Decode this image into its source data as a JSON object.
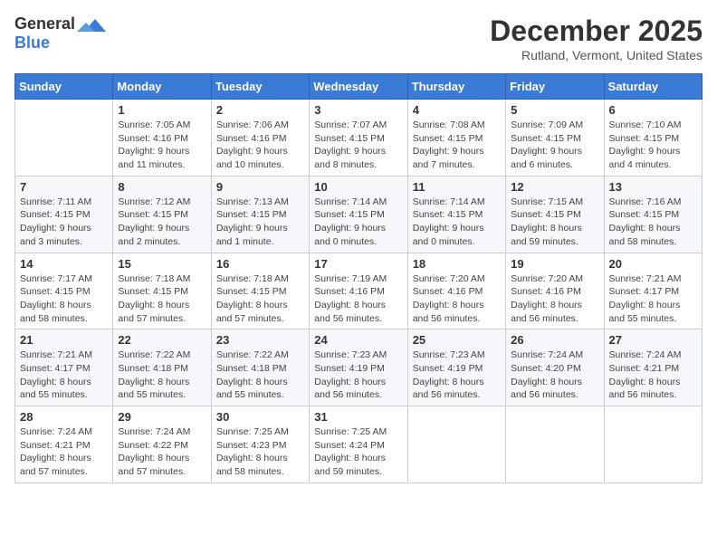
{
  "logo": {
    "general": "General",
    "blue": "Blue"
  },
  "title": "December 2025",
  "subtitle": "Rutland, Vermont, United States",
  "days_of_week": [
    "Sunday",
    "Monday",
    "Tuesday",
    "Wednesday",
    "Thursday",
    "Friday",
    "Saturday"
  ],
  "weeks": [
    [
      {
        "day": "",
        "info": ""
      },
      {
        "day": "1",
        "info": "Sunrise: 7:05 AM\nSunset: 4:16 PM\nDaylight: 9 hours\nand 11 minutes."
      },
      {
        "day": "2",
        "info": "Sunrise: 7:06 AM\nSunset: 4:16 PM\nDaylight: 9 hours\nand 10 minutes."
      },
      {
        "day": "3",
        "info": "Sunrise: 7:07 AM\nSunset: 4:15 PM\nDaylight: 9 hours\nand 8 minutes."
      },
      {
        "day": "4",
        "info": "Sunrise: 7:08 AM\nSunset: 4:15 PM\nDaylight: 9 hours\nand 7 minutes."
      },
      {
        "day": "5",
        "info": "Sunrise: 7:09 AM\nSunset: 4:15 PM\nDaylight: 9 hours\nand 6 minutes."
      },
      {
        "day": "6",
        "info": "Sunrise: 7:10 AM\nSunset: 4:15 PM\nDaylight: 9 hours\nand 4 minutes."
      }
    ],
    [
      {
        "day": "7",
        "info": "Sunrise: 7:11 AM\nSunset: 4:15 PM\nDaylight: 9 hours\nand 3 minutes."
      },
      {
        "day": "8",
        "info": "Sunrise: 7:12 AM\nSunset: 4:15 PM\nDaylight: 9 hours\nand 2 minutes."
      },
      {
        "day": "9",
        "info": "Sunrise: 7:13 AM\nSunset: 4:15 PM\nDaylight: 9 hours\nand 1 minute."
      },
      {
        "day": "10",
        "info": "Sunrise: 7:14 AM\nSunset: 4:15 PM\nDaylight: 9 hours\nand 0 minutes."
      },
      {
        "day": "11",
        "info": "Sunrise: 7:14 AM\nSunset: 4:15 PM\nDaylight: 9 hours\nand 0 minutes."
      },
      {
        "day": "12",
        "info": "Sunrise: 7:15 AM\nSunset: 4:15 PM\nDaylight: 8 hours\nand 59 minutes."
      },
      {
        "day": "13",
        "info": "Sunrise: 7:16 AM\nSunset: 4:15 PM\nDaylight: 8 hours\nand 58 minutes."
      }
    ],
    [
      {
        "day": "14",
        "info": "Sunrise: 7:17 AM\nSunset: 4:15 PM\nDaylight: 8 hours\nand 58 minutes."
      },
      {
        "day": "15",
        "info": "Sunrise: 7:18 AM\nSunset: 4:15 PM\nDaylight: 8 hours\nand 57 minutes."
      },
      {
        "day": "16",
        "info": "Sunrise: 7:18 AM\nSunset: 4:15 PM\nDaylight: 8 hours\nand 57 minutes."
      },
      {
        "day": "17",
        "info": "Sunrise: 7:19 AM\nSunset: 4:16 PM\nDaylight: 8 hours\nand 56 minutes."
      },
      {
        "day": "18",
        "info": "Sunrise: 7:20 AM\nSunset: 4:16 PM\nDaylight: 8 hours\nand 56 minutes."
      },
      {
        "day": "19",
        "info": "Sunrise: 7:20 AM\nSunset: 4:16 PM\nDaylight: 8 hours\nand 56 minutes."
      },
      {
        "day": "20",
        "info": "Sunrise: 7:21 AM\nSunset: 4:17 PM\nDaylight: 8 hours\nand 55 minutes."
      }
    ],
    [
      {
        "day": "21",
        "info": "Sunrise: 7:21 AM\nSunset: 4:17 PM\nDaylight: 8 hours\nand 55 minutes."
      },
      {
        "day": "22",
        "info": "Sunrise: 7:22 AM\nSunset: 4:18 PM\nDaylight: 8 hours\nand 55 minutes."
      },
      {
        "day": "23",
        "info": "Sunrise: 7:22 AM\nSunset: 4:18 PM\nDaylight: 8 hours\nand 55 minutes."
      },
      {
        "day": "24",
        "info": "Sunrise: 7:23 AM\nSunset: 4:19 PM\nDaylight: 8 hours\nand 56 minutes."
      },
      {
        "day": "25",
        "info": "Sunrise: 7:23 AM\nSunset: 4:19 PM\nDaylight: 8 hours\nand 56 minutes."
      },
      {
        "day": "26",
        "info": "Sunrise: 7:24 AM\nSunset: 4:20 PM\nDaylight: 8 hours\nand 56 minutes."
      },
      {
        "day": "27",
        "info": "Sunrise: 7:24 AM\nSunset: 4:21 PM\nDaylight: 8 hours\nand 56 minutes."
      }
    ],
    [
      {
        "day": "28",
        "info": "Sunrise: 7:24 AM\nSunset: 4:21 PM\nDaylight: 8 hours\nand 57 minutes."
      },
      {
        "day": "29",
        "info": "Sunrise: 7:24 AM\nSunset: 4:22 PM\nDaylight: 8 hours\nand 57 minutes."
      },
      {
        "day": "30",
        "info": "Sunrise: 7:25 AM\nSunset: 4:23 PM\nDaylight: 8 hours\nand 58 minutes."
      },
      {
        "day": "31",
        "info": "Sunrise: 7:25 AM\nSunset: 4:24 PM\nDaylight: 8 hours\nand 59 minutes."
      },
      {
        "day": "",
        "info": ""
      },
      {
        "day": "",
        "info": ""
      },
      {
        "day": "",
        "info": ""
      }
    ]
  ]
}
